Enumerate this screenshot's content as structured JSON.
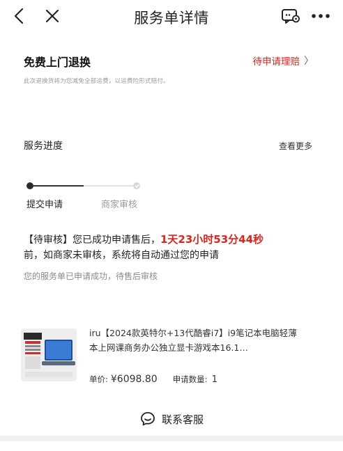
{
  "header": {
    "title": "服务单详情"
  },
  "service": {
    "title": "免费上门退换",
    "claim_label": "待申请理赔",
    "claim_chevron": "〉",
    "desc": "此次退换货将为您减免全部运费，以运费险形式赔付。"
  },
  "progress": {
    "title": "服务进度",
    "view_more": "查看更多",
    "steps": [
      {
        "label": "提交申请",
        "done": true
      },
      {
        "label": "商家审核",
        "done": false
      }
    ],
    "notice_prefix": "【待审核】您已成功申请售后，",
    "countdown": "1天23小时53分44秒",
    "notice_suffix": "前，如商家未审核，系统将自动通过您的申请",
    "sub_notice": "您的服务单已申请成功，待售后审核"
  },
  "product": {
    "title": "iru【2024款英特尔+13代酷睿i7】i9笔记本电脑轻薄本上网课商务办公独立显卡游戏本16.1…",
    "price_label": "单价:",
    "price": "¥6098.80",
    "qty_label": "申请数量:",
    "qty": "1"
  },
  "footer": {
    "contact_label": "联系客服"
  },
  "colors": {
    "accent": "#e2231a",
    "text": "#222222",
    "muted": "#9a9a9a"
  }
}
